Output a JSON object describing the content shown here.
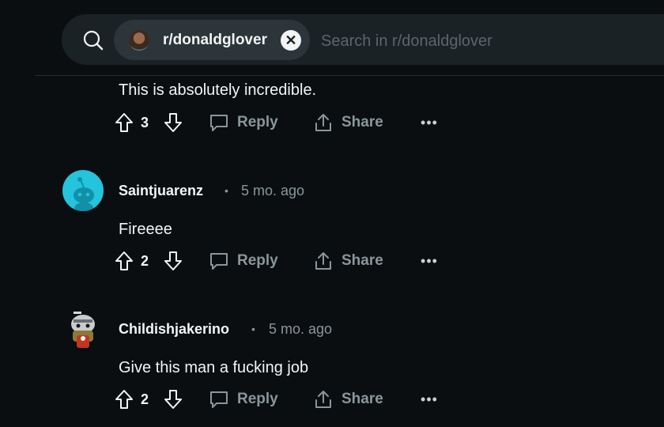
{
  "search": {
    "community_chip": "r/donaldglover",
    "close_glyph": "✕",
    "placeholder": "Search in r/donaldglover"
  },
  "comments": [
    {
      "text": "This is absolutely incredible.",
      "votes": "3",
      "reply_label": "Reply",
      "share_label": "Share",
      "more_label": "•••"
    },
    {
      "author": "Saintjuarenz",
      "separator": "•",
      "time": "5 mo. ago",
      "text": "Fireeee",
      "votes": "2",
      "reply_label": "Reply",
      "share_label": "Share",
      "more_label": "•••",
      "avatar_color": "#24c4dc"
    },
    {
      "author": "Childishjakerino",
      "separator": "•",
      "time": "5 mo. ago",
      "text": "Give this man a fucking job",
      "votes": "2",
      "reply_label": "Reply",
      "share_label": "Share",
      "more_label": "•••"
    }
  ],
  "colors": {
    "background": "#0b0e10",
    "searchbar": "#1b2226",
    "chip": "#2c3539",
    "muted_text": "#8a969b"
  },
  "icons": [
    "search-icon",
    "upvote-icon",
    "downvote-icon",
    "comment-bubble-icon",
    "share-icon",
    "more-icon",
    "close-icon"
  ]
}
